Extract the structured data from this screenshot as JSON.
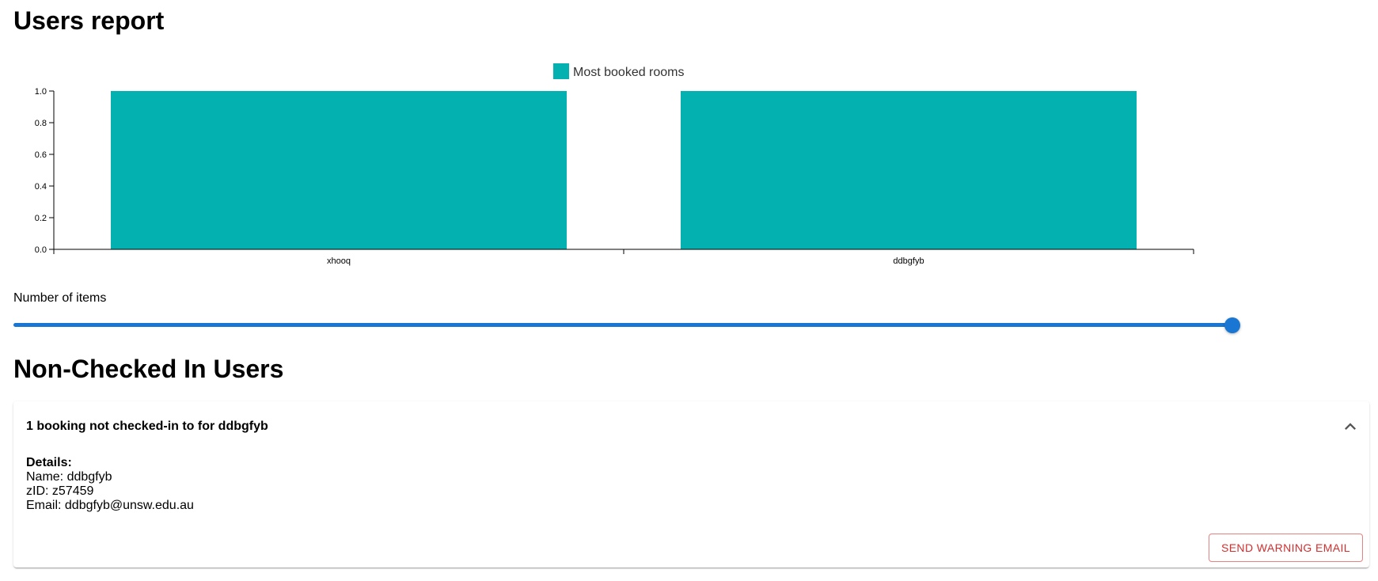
{
  "page": {
    "title": "Users report",
    "section_title": "Non-Checked In Users"
  },
  "chart_data": {
    "type": "bar",
    "categories": [
      "xhooq",
      "ddbgfyb"
    ],
    "series": [
      {
        "name": "Most booked rooms",
        "values": [
          1,
          1
        ],
        "color": "#03b2b0"
      }
    ],
    "ylim": [
      0,
      1
    ],
    "yticks": [
      "0.0",
      "0.2",
      "0.4",
      "0.6",
      "0.8",
      "1.0"
    ],
    "legend_position": "top-center",
    "grid": false
  },
  "slider": {
    "label": "Number of items",
    "value_fraction": 1.0,
    "color": "#1976d2"
  },
  "warnings": [
    {
      "header": "1 booking not checked-in to for ddbgfyb",
      "details_label": "Details:",
      "name_line": "Name: ddbgfyb",
      "zid_line": "zID: z57459",
      "email_line": "Email: ddbgfyb@unsw.edu.au",
      "button_label": "SEND WARNING EMAIL",
      "button_color": "#d32f2f",
      "expanded_icon": "chevron-up-icon"
    }
  ]
}
